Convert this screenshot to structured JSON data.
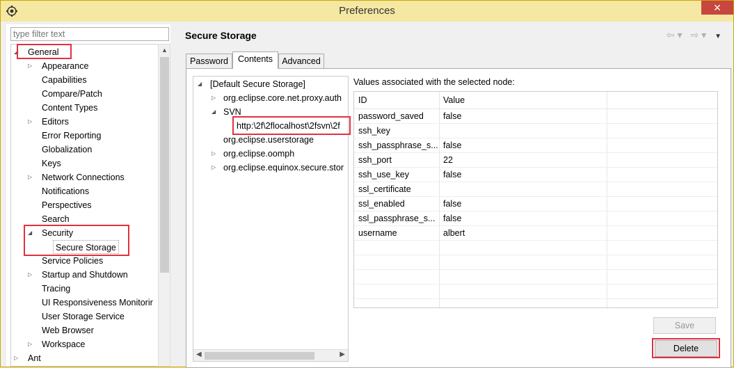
{
  "window": {
    "title": "Preferences",
    "close_symbol": "✕"
  },
  "filter": {
    "placeholder": "type filter text"
  },
  "nav_tree": {
    "items": [
      {
        "label": "General",
        "expanded": true
      },
      {
        "label": "Appearance",
        "expandable": true
      },
      {
        "label": "Capabilities"
      },
      {
        "label": "Compare/Patch"
      },
      {
        "label": "Content Types"
      },
      {
        "label": "Editors",
        "expandable": true
      },
      {
        "label": "Error Reporting"
      },
      {
        "label": "Globalization"
      },
      {
        "label": "Keys"
      },
      {
        "label": "Network Connections",
        "expandable": true
      },
      {
        "label": "Notifications"
      },
      {
        "label": "Perspectives"
      },
      {
        "label": "Search"
      },
      {
        "label": "Security",
        "expanded": true
      },
      {
        "label": "Secure Storage",
        "selected": true
      },
      {
        "label": "Service Policies"
      },
      {
        "label": "Startup and Shutdown",
        "expandable": true
      },
      {
        "label": "Tracing"
      },
      {
        "label": "UI Responsiveness Monitorir"
      },
      {
        "label": "User Storage Service"
      },
      {
        "label": "Web Browser"
      },
      {
        "label": "Workspace",
        "expandable": true
      },
      {
        "label": "Ant",
        "expandable": true
      }
    ]
  },
  "page": {
    "title": "Secure Storage"
  },
  "tabs": [
    {
      "label": "Password"
    },
    {
      "label": "Contents",
      "active": true
    },
    {
      "label": "Advanced"
    }
  ],
  "nodes": [
    {
      "label": "[Default Secure Storage]"
    },
    {
      "label": "org.eclipse.core.net.proxy.auth"
    },
    {
      "label": "SVN"
    },
    {
      "label": "http:\\2f\\2flocalhost\\2fsvn\\2f"
    },
    {
      "label": "org.eclipse.userstorage"
    },
    {
      "label": "org.eclipse.oomph"
    },
    {
      "label": "org.eclipse.equinox.secure.stor"
    }
  ],
  "values_panel": {
    "label": "Values associated with the selected node:",
    "columns": [
      "ID",
      "Value"
    ],
    "rows": [
      {
        "id": "password_saved",
        "value": "false"
      },
      {
        "id": "ssh_key",
        "value": ""
      },
      {
        "id": "ssh_passphrase_s...",
        "value": "false"
      },
      {
        "id": "ssh_port",
        "value": "22"
      },
      {
        "id": "ssh_use_key",
        "value": "false"
      },
      {
        "id": "ssl_certificate",
        "value": ""
      },
      {
        "id": "ssl_enabled",
        "value": "false"
      },
      {
        "id": "ssl_passphrase_s...",
        "value": "false"
      },
      {
        "id": "username",
        "value": "albert"
      }
    ]
  },
  "buttons": {
    "save": "Save",
    "delete": "Delete"
  },
  "colors": {
    "highlight": "#e03040",
    "title_bar": "#f5e8a3",
    "close": "#c7463f"
  }
}
